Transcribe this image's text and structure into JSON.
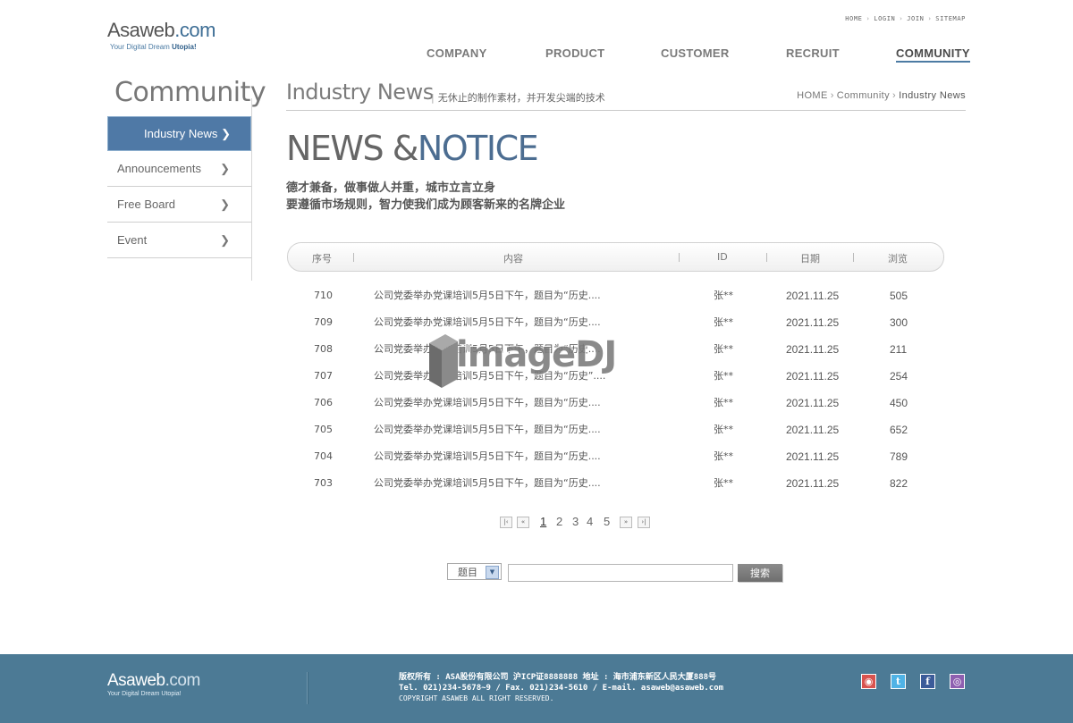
{
  "logo": {
    "main": "Asaweb",
    "dot": ".com",
    "tagline_a": "Your Digital Dream ",
    "tagline_b": "Utopia!"
  },
  "util_links": [
    "HOME",
    "LOGIN",
    "JOIN",
    "SITEMAP"
  ],
  "nav": [
    "COMPANY",
    "PRODUCT",
    "CUSTOMER",
    "RECRUIT",
    "COMMUNITY"
  ],
  "sidebar": {
    "title": "Community",
    "items": [
      "Industry News",
      "Announcements",
      "Free Board",
      "Event"
    ]
  },
  "page": {
    "title": "Industry News",
    "subtitle": "无休止的制作素材，并开发尖端的技术",
    "breadcrumb": [
      "HOME",
      "Community",
      "Industry News"
    ]
  },
  "hero": {
    "part1": "NEWS &",
    "part2": "NOTICE"
  },
  "intro": [
    "德才兼备，做事做人并重，城市立言立身",
    "要遵循市场规则，智力使我们成为顾客新来的名牌企业"
  ],
  "table": {
    "headers": [
      "序号",
      "内容",
      "ID",
      "日期",
      "浏览"
    ],
    "rows": [
      {
        "no": "710",
        "title": "公司党委举办党课培训5月5日下午，题目为“历史....",
        "id": "张**",
        "date": "2021.11.25",
        "views": "505"
      },
      {
        "no": "709",
        "title": "公司党委举办党课培训5月5日下午，题目为“历史....",
        "id": "张**",
        "date": "2021.11.25",
        "views": "300"
      },
      {
        "no": "708",
        "title": "公司党委举办党课培训5月5日下午，题目为“历史....",
        "id": "张**",
        "date": "2021.11.25",
        "views": "211"
      },
      {
        "no": "707",
        "title": "公司党委举办党课培训5月5日下午，题目为“历史”....",
        "id": "张**",
        "date": "2021.11.25",
        "views": "254"
      },
      {
        "no": "706",
        "title": "公司党委举办党课培训5月5日下午，题目为“历史....",
        "id": "张**",
        "date": "2021.11.25",
        "views": "450"
      },
      {
        "no": "705",
        "title": "公司党委举办党课培训5月5日下午，题目为“历史....",
        "id": "张**",
        "date": "2021.11.25",
        "views": "652"
      },
      {
        "no": "704",
        "title": "公司党委举办党课培训5月5日下午，题目为“历史....",
        "id": "张**",
        "date": "2021.11.25",
        "views": "789"
      },
      {
        "no": "703",
        "title": "公司党委举办党课培训5月5日下午，题目为“历史....",
        "id": "张**",
        "date": "2021.11.25",
        "views": "822"
      }
    ]
  },
  "pagination": {
    "pages": [
      "1",
      "2",
      "3",
      "4",
      "5"
    ],
    "current": "1"
  },
  "search": {
    "select_value": "题目",
    "input_value": "",
    "button": "搜索"
  },
  "watermark": "imageDJ",
  "footer": {
    "logo_main": "Asaweb",
    "logo_dot": ".com",
    "tagline": "Your Digital Dream Utopia!",
    "line1": "版权所有 : ASA股份有限公司 沪ICP证8888888   地址 : 海市浦东新区人民大厦888号",
    "line2": "Tel. 021)234-5678~9  / Fax. 021)234-5610  / E-mail. asaweb@asaweb.com",
    "line3": "COPYRIGHT ASAWEB ALL RIGHT RESERVED.",
    "social_icons": [
      "weibo-icon",
      "twitter-icon",
      "facebook-icon",
      "chat-icon"
    ]
  },
  "colors": {
    "accent": "#4f79a6",
    "footer_bg": "#4c7a95",
    "hero_blue": "#4c6d91"
  }
}
